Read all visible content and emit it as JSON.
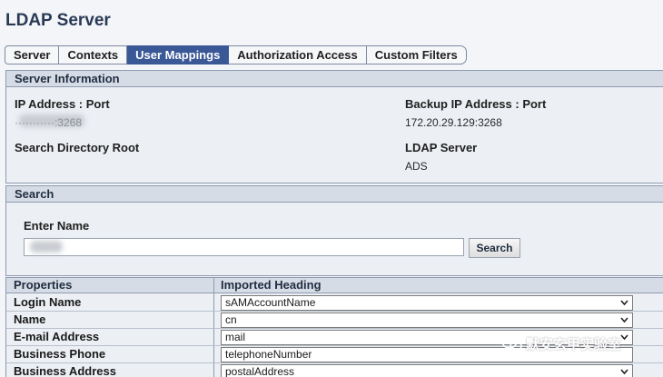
{
  "page": {
    "title": "LDAP Server"
  },
  "tabs": [
    {
      "label": "Server",
      "active": false
    },
    {
      "label": "Contexts",
      "active": false
    },
    {
      "label": "User Mappings",
      "active": true
    },
    {
      "label": "Authorization Access",
      "active": false
    },
    {
      "label": "Custom Filters",
      "active": false
    }
  ],
  "server_info": {
    "heading": "Server Information",
    "ip_port_label": "IP Address : Port",
    "ip_port_value": "···········:3268",
    "backup_label": "Backup IP Address : Port",
    "backup_value": "172.20.29.129:3268",
    "root_label": "Search Directory Root",
    "ldap_label": "LDAP Server",
    "ldap_value": "ADS"
  },
  "search": {
    "heading": "Search",
    "enter_name_label": "Enter Name",
    "input_value": "",
    "button_label": "Search"
  },
  "mappings": {
    "col_properties": "Properties",
    "col_imported": "Imported Heading",
    "rows": [
      {
        "label": "Login Name",
        "value": "sAMAccountName"
      },
      {
        "label": "Name",
        "value": "cn"
      },
      {
        "label": "E-mail Address",
        "value": "mail"
      },
      {
        "label": "Business Phone",
        "value": "telephoneNumber"
      },
      {
        "label": "Business Address",
        "value": "postalAddress"
      }
    ]
  },
  "watermark": {
    "text": "默安玄甲实验室"
  }
}
